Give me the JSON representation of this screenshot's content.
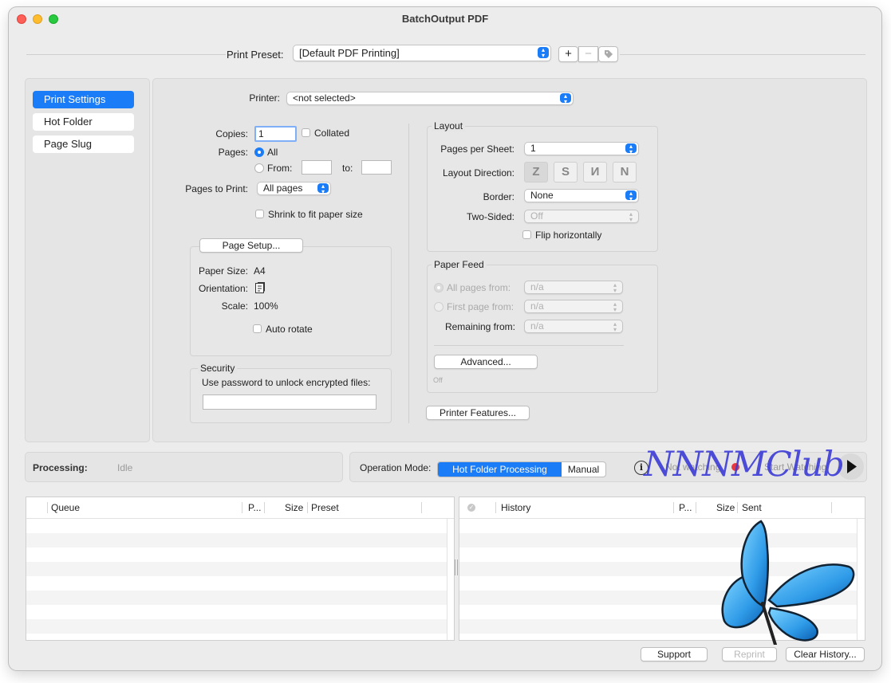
{
  "window": {
    "title": "BatchOutput PDF"
  },
  "preset": {
    "label": "Print Preset:",
    "value": "[Default PDF Printing]",
    "add": "+",
    "remove": "−"
  },
  "sidebar": {
    "items": [
      {
        "label": "Print Settings"
      },
      {
        "label": "Hot Folder"
      },
      {
        "label": "Page Slug"
      }
    ]
  },
  "printer": {
    "label": "Printer:",
    "value": "<not selected>"
  },
  "copies": {
    "label": "Copies:",
    "value": "1",
    "collated": "Collated"
  },
  "pages": {
    "label": "Pages:",
    "all": "All",
    "from": "From:",
    "to": "to:"
  },
  "pages_to_print": {
    "label": "Pages to Print:",
    "value": "All pages"
  },
  "shrink": "Shrink to fit paper size",
  "page_setup": {
    "button": "Page Setup...",
    "paper_size_label": "Paper Size:",
    "paper_size": "A4",
    "orientation_label": "Orientation:",
    "scale_label": "Scale:",
    "scale": "100%",
    "auto_rotate": "Auto rotate"
  },
  "security": {
    "title": "Security",
    "hint": "Use password to unlock encrypted files:"
  },
  "layout": {
    "title": "Layout",
    "pages_per_sheet_label": "Pages per Sheet:",
    "pages_per_sheet": "1",
    "direction_label": "Layout Direction:",
    "border_label": "Border:",
    "border": "None",
    "two_sided_label": "Two-Sided:",
    "two_sided": "Off",
    "flip": "Flip horizontally"
  },
  "paper_feed": {
    "title": "Paper Feed",
    "all_pages": "All pages from:",
    "first_page": "First page from:",
    "remaining": "Remaining from:",
    "na": "n/a",
    "advanced": "Advanced...",
    "off": "Off"
  },
  "printer_features": "Printer Features...",
  "status": {
    "processing_label": "Processing:",
    "processing_value": "Idle"
  },
  "operation": {
    "label": "Operation Mode:",
    "hot_folder": "Hot Folder Processing",
    "manual": "Manual",
    "watch_status": "Not watching",
    "start": "Start Watching"
  },
  "watermark": "NNNMClub",
  "queue": {
    "columns": [
      "Queue",
      "P...",
      "Size",
      "Preset"
    ]
  },
  "history": {
    "columns": [
      "History",
      "P...",
      "Size",
      "Sent"
    ]
  },
  "footer": {
    "support": "Support",
    "reprint": "Reprint",
    "clear": "Clear History..."
  },
  "colors": {
    "accent": "#1b7cf7",
    "window_bg": "#ececec",
    "watermark": "#3b3bd6",
    "butterfly": "#2f9be8"
  },
  "icons": [
    "info-icon",
    "record-icon",
    "play-icon",
    "tag-icon",
    "butterfly-logo"
  ]
}
